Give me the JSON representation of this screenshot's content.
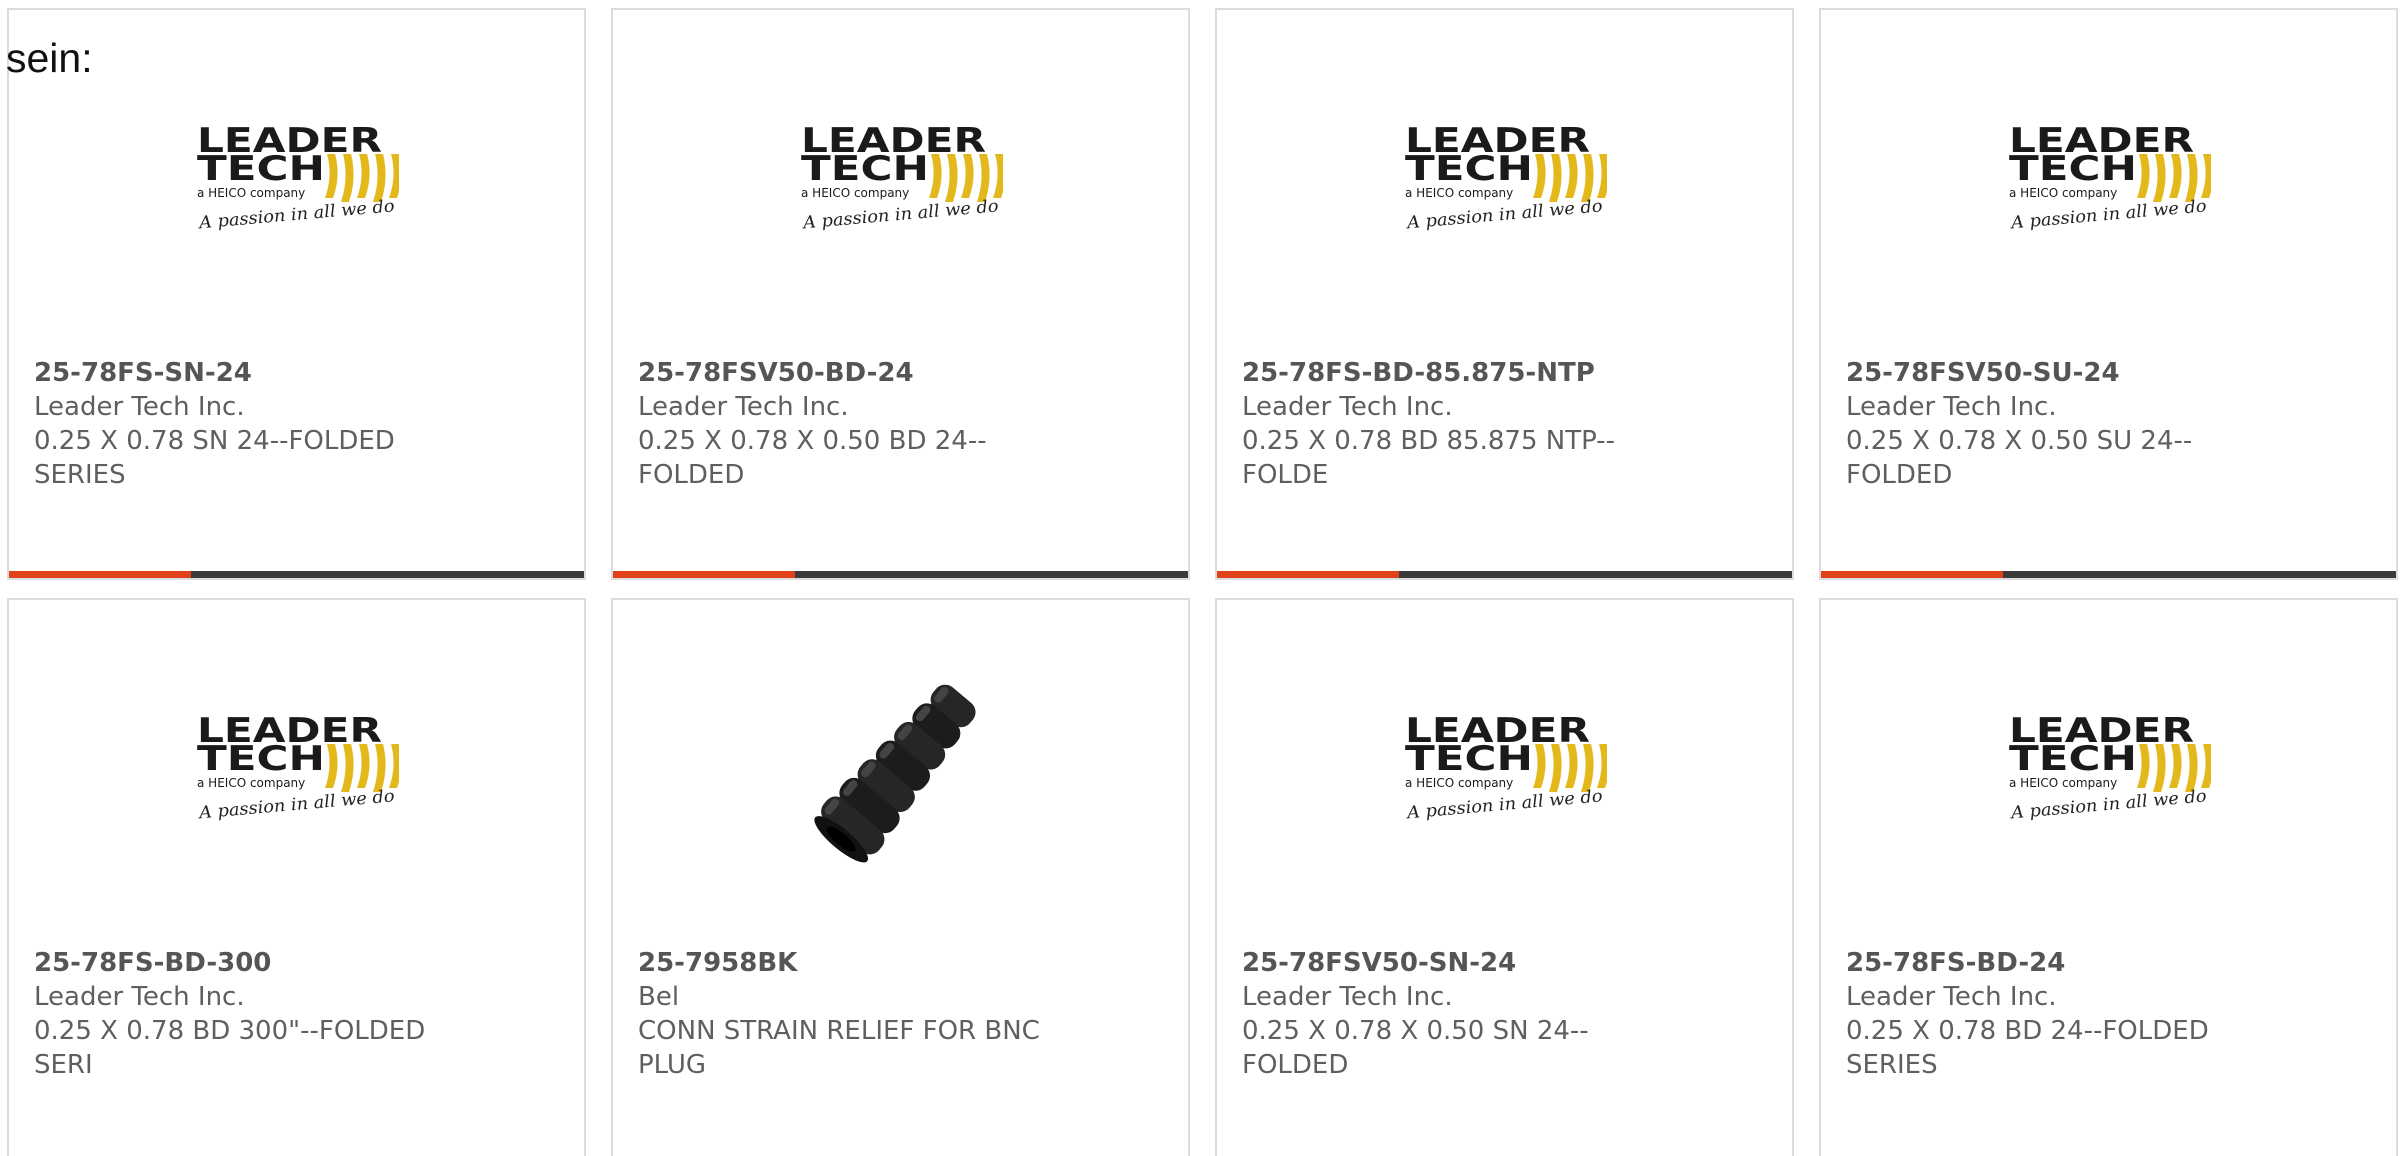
{
  "intro_text": "sein:",
  "accent_color": "#e0401a",
  "bar_color": "#3b3b3b",
  "logo": {
    "line1": "LEADER",
    "line2": "TECH",
    "tagline": "a HEICO company",
    "script": "A passion in all we do"
  },
  "products": [
    {
      "part": "25-78FS-SN-24",
      "maker": "Leader Tech Inc.",
      "desc": "0.25 X 0.78 SN 24--FOLDED SERIES",
      "image": "leader-tech-logo"
    },
    {
      "part": "25-78FSV50-BD-24",
      "maker": "Leader Tech Inc.",
      "desc": "0.25 X 0.78 X 0.50 BD 24--FOLDED",
      "image": "leader-tech-logo"
    },
    {
      "part": "25-78FS-BD-85.875-NTP",
      "maker": "Leader Tech Inc.",
      "desc": "0.25 X 0.78 BD 85.875 NTP--FOLDE",
      "image": "leader-tech-logo"
    },
    {
      "part": "25-78FSV50-SU-24",
      "maker": "Leader Tech Inc.",
      "desc": "0.25 X 0.78 X 0.50 SU 24--FOLDED",
      "image": "leader-tech-logo"
    },
    {
      "part": "25-78FS-BD-300",
      "maker": "Leader Tech Inc.",
      "desc": "0.25 X 0.78 BD 300\"--FOLDED SERI",
      "image": "leader-tech-logo"
    },
    {
      "part": "25-7958BK",
      "maker": "Bel",
      "desc": "CONN STRAIN RELIEF FOR BNC PLUG",
      "image": "strain-relief-boot"
    },
    {
      "part": "25-78FSV50-SN-24",
      "maker": "Leader Tech Inc.",
      "desc": "0.25 X 0.78 X 0.50 SN 24--FOLDED",
      "image": "leader-tech-logo"
    },
    {
      "part": "25-78FS-BD-24",
      "maker": "Leader Tech Inc.",
      "desc": "0.25 X 0.78 BD 24--FOLDED SERIES",
      "image": "leader-tech-logo"
    }
  ]
}
